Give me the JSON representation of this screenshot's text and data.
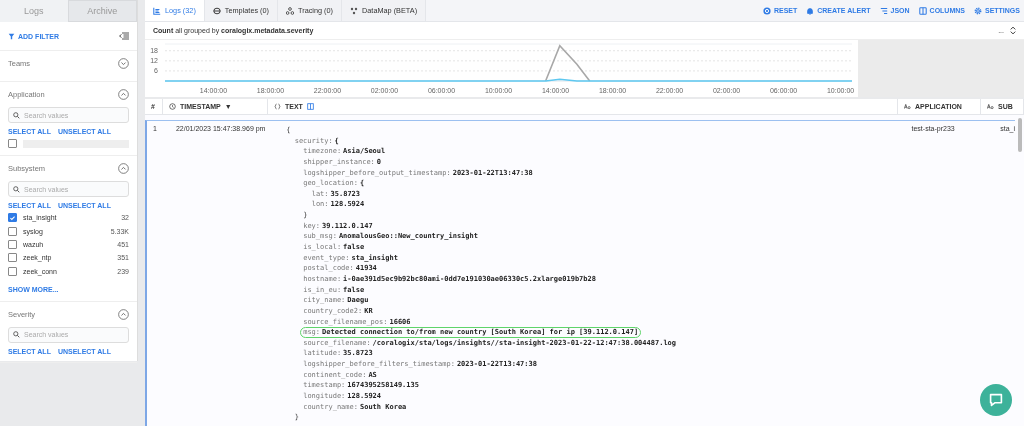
{
  "sidebar": {
    "tabs": [
      {
        "label": "Logs",
        "selected": true
      },
      {
        "label": "Archive",
        "selected": false
      }
    ],
    "add_filter": "ADD FILTER",
    "sections": [
      {
        "title": "Teams",
        "expanded": false
      },
      {
        "title": "Application",
        "expanded": true,
        "search": {
          "placeholder": "Search values"
        },
        "select_all": "SELECT ALL",
        "unselect_all": "UNSELECT ALL",
        "items": [
          {
            "kind": "loading",
            "checked": false
          }
        ]
      },
      {
        "title": "Subsystem",
        "expanded": true,
        "search": {
          "placeholder": "Search values"
        },
        "select_all": "SELECT ALL",
        "unselect_all": "UNSELECT ALL",
        "items": [
          {
            "kind": "value",
            "label": "sta_insight",
            "count": "32",
            "checked": true
          },
          {
            "kind": "value",
            "label": "syslog",
            "count": "5.33K",
            "checked": false
          },
          {
            "kind": "value",
            "label": "wazuh",
            "count": "451",
            "checked": false
          },
          {
            "kind": "value",
            "label": "zeek_ntp",
            "count": "351",
            "checked": false
          },
          {
            "kind": "value",
            "label": "zeek_conn",
            "count": "239",
            "checked": false
          }
        ],
        "show_more": "SHOW MORE..."
      },
      {
        "title": "Severity",
        "expanded": true,
        "search": {
          "placeholder": "Search values"
        },
        "select_all": "SELECT ALL",
        "unselect_all": "UNSELECT ALL"
      }
    ]
  },
  "tabs": [
    {
      "label": "Logs (32)",
      "selected": true
    },
    {
      "label": "Templates (0)",
      "selected": false
    },
    {
      "label": "Tracing (0)",
      "selected": false
    },
    {
      "label": "DataMap (BETA)",
      "selected": false
    }
  ],
  "actions": [
    "RESET",
    "CREATE ALERT",
    "JSON",
    "COLUMNS",
    "SETTINGS"
  ],
  "chart_header": {
    "title": "**Count** all grouped by **coralogix.metadata.severity**",
    "more": "..."
  },
  "chart": {
    "chart_data": {
      "type": "line",
      "grid": true,
      "x": [
        "2023-01-21T10:36:00",
        "2023-01-22T13:18:00",
        "2023-01-22T14:18:00",
        "2023-01-22T15:30:00",
        "2023-01-22T16:24:00",
        "2023-01-23T10:48:00"
      ],
      "series": [
        {
          "color": "#a8a8a8",
          "values": [
            null,
            0,
            21,
            10,
            0,
            null
          ]
        },
        {
          "color": "#5ec8f0",
          "values": [
            0,
            0,
            1,
            0,
            0,
            0
          ]
        }
      ],
      "xlim": [
        "2023-01-21T10:36:00",
        "2023-01-23T10:48:00"
      ],
      "ylim": [
        0,
        22
      ],
      "yticks": [
        6,
        12,
        18
      ],
      "xticks": [
        {
          "value": "2023-01-21T14:00:00",
          "label": "14:00:00"
        },
        {
          "value": "2023-01-21T18:00:00",
          "label": "18:00:00"
        },
        {
          "value": "2023-01-21T22:00:00",
          "label": "22:00:00"
        },
        {
          "value": "2023-01-22T02:00:00",
          "label": "02:00:00"
        },
        {
          "value": "2023-01-22T06:00:00",
          "label": "06:00:00"
        },
        {
          "value": "2023-01-22T10:00:00",
          "label": "10:00:00"
        },
        {
          "value": "2023-01-22T14:00:00",
          "label": "14:00:00"
        },
        {
          "value": "2023-01-22T18:00:00",
          "label": "18:00:00"
        },
        {
          "value": "2023-01-22T22:00:00",
          "label": "22:00:00"
        },
        {
          "value": "2023-01-23T02:00:00",
          "label": "02:00:00"
        },
        {
          "value": "2023-01-23T06:00:00",
          "label": "06:00:00"
        },
        {
          "value": "2023-01-23T10:00:00",
          "label": "10:00:00"
        }
      ]
    }
  },
  "table": {
    "columns": [
      {
        "label": "#"
      },
      {
        "label": "TIMESTAMP",
        "sort": "▼"
      },
      {
        "label": "TEXT"
      },
      {
        "label": "APPLICATION"
      },
      {
        "label": "SUB"
      }
    ],
    "rows": [
      {
        "selected": true,
        "index": "1",
        "timestamp": "22/01/2023 15:47:38.969 pm",
        "application": "test-sta-pr233",
        "subsystem": "sta_i",
        "text": {
          "open": "{",
          "lines": [
            {
              "key": "security:",
              "open": "{",
              "close": "}",
              "children": [
                {
                  "key": "timezone:",
                  "value": "Asia/Seoul"
                },
                {
                  "key": "shipper_instance:",
                  "value": "0"
                },
                {
                  "key": "logshipper_before_output_timestamp:",
                  "value": "2023-01-22T13:47:38"
                },
                {
                  "key": "geo_location:",
                  "open": "{",
                  "close": "}",
                  "children": [
                    {
                      "key": "lat:",
                      "value": "35.8723"
                    },
                    {
                      "key": "lon:",
                      "value": "128.5924"
                    }
                  ]
                },
                {
                  "key": "key:",
                  "value": "39.112.0.147"
                },
                {
                  "key": "sub_msg:",
                  "value": "AnomalousGeo::New_country_insight"
                },
                {
                  "key": "is_local:",
                  "value": "false"
                },
                {
                  "key": "event_type:",
                  "value": "sta_insight"
                },
                {
                  "key": "postal_code:",
                  "value": "41934"
                },
                {
                  "key": "hostname:",
                  "value": "i-0ae391d5ec9b92bc80ami-0dd7e191030ae06330c5.2xlarge019b7b28"
                },
                {
                  "key": "is_in_eu:",
                  "value": "false"
                },
                {
                  "key": "city_name:",
                  "value": "Daegu"
                },
                {
                  "key": "country_code2:",
                  "value": "KR"
                },
                {
                  "key": "source_filename_pos:",
                  "value": "16606"
                },
                {
                  "key": "msg:",
                  "value": "Detected connection to/from new country [South Korea] for ip [39.112.0.147]",
                  "highlighted": true
                },
                {
                  "key": "source_filename:",
                  "value": "/coralogix/sta/logs/insights//sta-insight-2023-01-22-12:47:38.004487.log"
                },
                {
                  "key": "latitude:",
                  "value": "35.8723"
                },
                {
                  "key": "logshipper_before_filters_timestamp:",
                  "value": "2023-01-22T13:47:38"
                },
                {
                  "key": "continent_code:",
                  "value": "AS"
                },
                {
                  "key": "timestamp:",
                  "value": "1674395258149.135"
                },
                {
                  "key": "longitude:",
                  "value": "128.5924"
                },
                {
                  "key": "country_name:",
                  "value": "South Korea"
                }
              ]
            }
          ]
        }
      }
    ]
  }
}
